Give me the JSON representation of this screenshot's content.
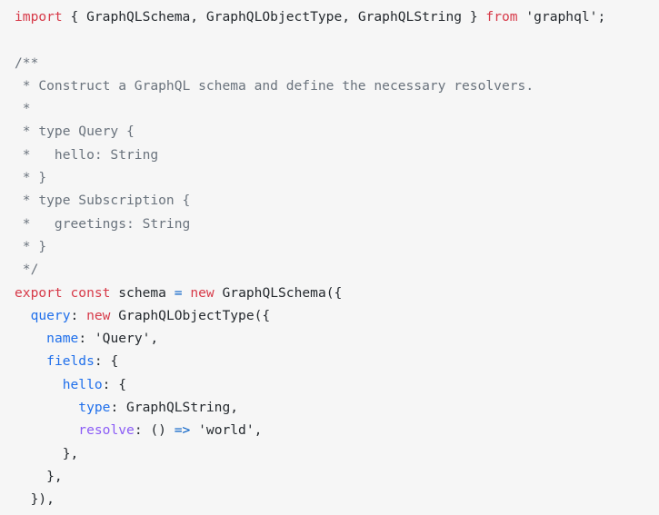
{
  "editor": {
    "language": "javascript",
    "background_color": "#f6f6f6",
    "foreground_color": "#24292e",
    "font_size_px": 14.6,
    "line_height_px": 25.3
  },
  "theme": {
    "keyword_color": "#d73a49",
    "comment_color": "#6a737d",
    "property_color": "#1f6feb",
    "resolve_color": "#8b5cf6",
    "operator_color": "#005cc5",
    "plain_color": "#24292e",
    "string_color": "#24292e"
  },
  "code": {
    "lines": [
      {
        "index": 1,
        "text": "import { GraphQLSchema, GraphQLObjectType, GraphQLString } from 'graphql';",
        "tokens": [
          {
            "t": "import",
            "k": "keyword"
          },
          {
            "t": " ",
            "k": "plain"
          },
          {
            "t": "{ GraphQLSchema, GraphQLObjectType, GraphQLString }",
            "k": "plain"
          },
          {
            "t": " ",
            "k": "plain"
          },
          {
            "t": "from",
            "k": "keyword"
          },
          {
            "t": " ",
            "k": "plain"
          },
          {
            "t": "'graphql'",
            "k": "string"
          },
          {
            "t": ";",
            "k": "punct"
          }
        ]
      },
      {
        "index": 2,
        "text": "",
        "tokens": []
      },
      {
        "index": 3,
        "text": "/**",
        "tokens": [
          {
            "t": "/**",
            "k": "comment"
          }
        ]
      },
      {
        "index": 4,
        "text": " * Construct a GraphQL schema and define the necessary resolvers.",
        "tokens": [
          {
            "t": " * Construct a GraphQL schema and define the necessary resolvers.",
            "k": "comment"
          }
        ]
      },
      {
        "index": 5,
        "text": " *",
        "tokens": [
          {
            "t": " *",
            "k": "comment"
          }
        ]
      },
      {
        "index": 6,
        "text": " * type Query {",
        "tokens": [
          {
            "t": " * type Query {",
            "k": "comment"
          }
        ]
      },
      {
        "index": 7,
        "text": " *   hello: String",
        "tokens": [
          {
            "t": " *   hello: String",
            "k": "comment"
          }
        ]
      },
      {
        "index": 8,
        "text": " * }",
        "tokens": [
          {
            "t": " * }",
            "k": "comment"
          }
        ]
      },
      {
        "index": 9,
        "text": " * type Subscription {",
        "tokens": [
          {
            "t": " * type Subscription {",
            "k": "comment"
          }
        ]
      },
      {
        "index": 10,
        "text": " *   greetings: String",
        "tokens": [
          {
            "t": " *   greetings: String",
            "k": "comment"
          }
        ]
      },
      {
        "index": 11,
        "text": " * }",
        "tokens": [
          {
            "t": " * }",
            "k": "comment"
          }
        ]
      },
      {
        "index": 12,
        "text": " */",
        "tokens": [
          {
            "t": " */",
            "k": "comment"
          }
        ]
      },
      {
        "index": 13,
        "text": "export const schema = new GraphQLSchema({",
        "tokens": [
          {
            "t": "export",
            "k": "keyword"
          },
          {
            "t": " ",
            "k": "plain"
          },
          {
            "t": "const",
            "k": "keyword"
          },
          {
            "t": " ",
            "k": "plain"
          },
          {
            "t": "schema",
            "k": "plain"
          },
          {
            "t": " ",
            "k": "plain"
          },
          {
            "t": "=",
            "k": "operator"
          },
          {
            "t": " ",
            "k": "plain"
          },
          {
            "t": "new",
            "k": "keyword"
          },
          {
            "t": " ",
            "k": "plain"
          },
          {
            "t": "GraphQLSchema({",
            "k": "plain"
          }
        ]
      },
      {
        "index": 14,
        "text": "  query: new GraphQLObjectType({",
        "tokens": [
          {
            "t": "  ",
            "k": "plain"
          },
          {
            "t": "query",
            "k": "property"
          },
          {
            "t": ": ",
            "k": "punct"
          },
          {
            "t": "new",
            "k": "keyword"
          },
          {
            "t": " ",
            "k": "plain"
          },
          {
            "t": "GraphQLObjectType({",
            "k": "plain"
          }
        ]
      },
      {
        "index": 15,
        "text": "    name: 'Query',",
        "tokens": [
          {
            "t": "    ",
            "k": "plain"
          },
          {
            "t": "name",
            "k": "property"
          },
          {
            "t": ": ",
            "k": "punct"
          },
          {
            "t": "'Query'",
            "k": "string"
          },
          {
            "t": ",",
            "k": "punct"
          }
        ]
      },
      {
        "index": 16,
        "text": "    fields: {",
        "tokens": [
          {
            "t": "    ",
            "k": "plain"
          },
          {
            "t": "fields",
            "k": "property"
          },
          {
            "t": ": {",
            "k": "punct"
          }
        ]
      },
      {
        "index": 17,
        "text": "      hello: {",
        "tokens": [
          {
            "t": "      ",
            "k": "plain"
          },
          {
            "t": "hello",
            "k": "property"
          },
          {
            "t": ": {",
            "k": "punct"
          }
        ]
      },
      {
        "index": 18,
        "text": "        type: GraphQLString,",
        "tokens": [
          {
            "t": "        ",
            "k": "plain"
          },
          {
            "t": "type",
            "k": "property"
          },
          {
            "t": ": ",
            "k": "punct"
          },
          {
            "t": "GraphQLString",
            "k": "plain"
          },
          {
            "t": ",",
            "k": "punct"
          }
        ]
      },
      {
        "index": 19,
        "text": "        resolve: () => 'world',",
        "tokens": [
          {
            "t": "        ",
            "k": "plain"
          },
          {
            "t": "resolve",
            "k": "resolve"
          },
          {
            "t": ": () ",
            "k": "punct"
          },
          {
            "t": "=>",
            "k": "operator"
          },
          {
            "t": " ",
            "k": "plain"
          },
          {
            "t": "'world'",
            "k": "string"
          },
          {
            "t": ",",
            "k": "punct"
          }
        ]
      },
      {
        "index": 20,
        "text": "      },",
        "tokens": [
          {
            "t": "      },",
            "k": "punct"
          }
        ]
      },
      {
        "index": 21,
        "text": "    },",
        "tokens": [
          {
            "t": "    },",
            "k": "punct"
          }
        ]
      },
      {
        "index": 22,
        "text": "  }),",
        "tokens": [
          {
            "t": "  }),",
            "k": "punct"
          }
        ]
      }
    ]
  }
}
